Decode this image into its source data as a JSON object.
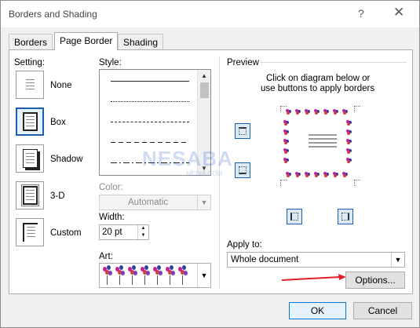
{
  "window": {
    "title": "Borders and Shading",
    "help_glyph": "?",
    "close_glyph": "✕"
  },
  "tabs": [
    {
      "label": "Borders",
      "active": false
    },
    {
      "label": "Page Border",
      "active": true
    },
    {
      "label": "Shading",
      "active": false
    }
  ],
  "setting": {
    "label": "Setting:",
    "options": [
      {
        "label": "None",
        "selected": false
      },
      {
        "label": "Box",
        "selected": true
      },
      {
        "label": "Shadow",
        "selected": false
      },
      {
        "label": "3-D",
        "selected": false
      },
      {
        "label": "Custom",
        "selected": false
      }
    ]
  },
  "style": {
    "label": "Style:",
    "lines": [
      "solid",
      "dotted",
      "dashed",
      "dashed-long",
      "dash-dot"
    ]
  },
  "color": {
    "label": "Color:",
    "value": "Automatic",
    "disabled": true
  },
  "width": {
    "label": "Width:",
    "value": "20 pt"
  },
  "art": {
    "label": "Art:",
    "icon": "balloons-art"
  },
  "preview": {
    "label": "Preview",
    "instruction_line1": "Click on diagram below or",
    "instruction_line2": "use buttons to apply borders"
  },
  "apply_to": {
    "label": "Apply to:",
    "value": "Whole document"
  },
  "buttons": {
    "options": "Options...",
    "ok": "OK",
    "cancel": "Cancel"
  },
  "watermark": {
    "text": "NESABA",
    "sub": "MEDIA.COM"
  },
  "colors": {
    "accent": "#1a5fb4",
    "arrow": "#e0202a"
  }
}
